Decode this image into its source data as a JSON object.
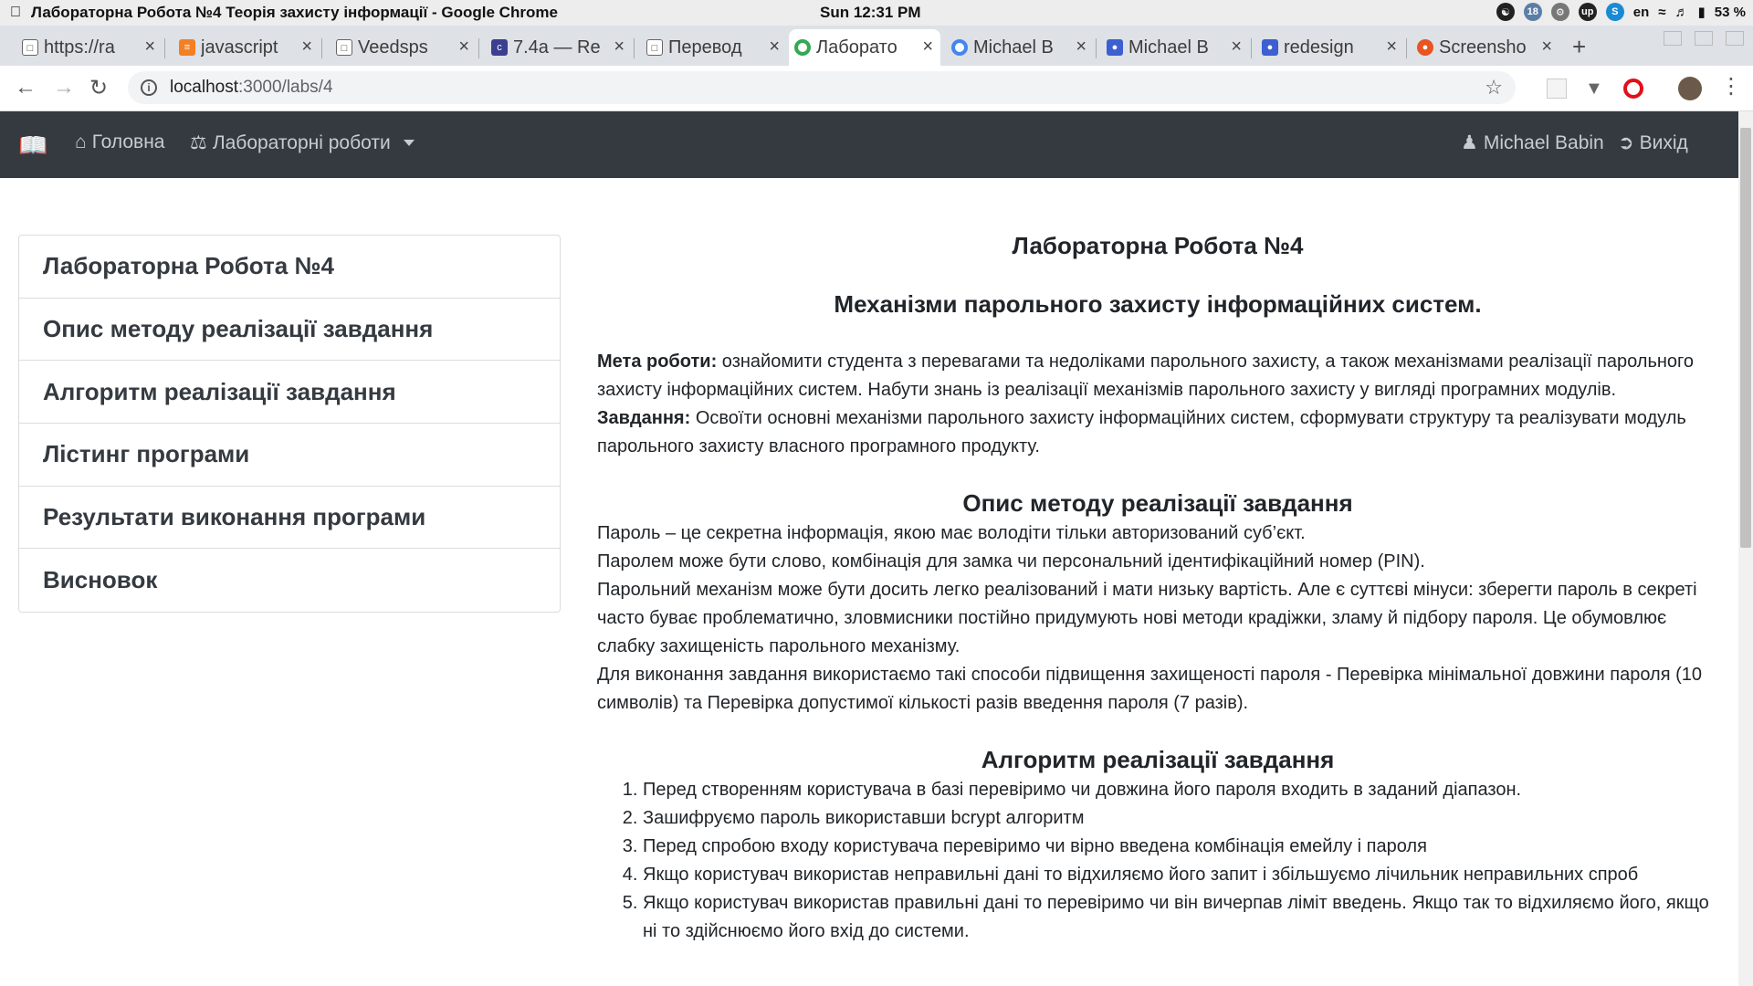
{
  "os": {
    "window_title": "Лабораторна Робота №4 Теорія захисту інформації - Google Chrome",
    "clock": "Sun 12:31 PM",
    "lang": "en",
    "battery": "53 %",
    "tray_badge": "18"
  },
  "tabs": [
    {
      "label": "https://ra",
      "favicon": "page-icon"
    },
    {
      "label": "javascript",
      "favicon": "stackoverflow-icon"
    },
    {
      "label": "Veedsps",
      "favicon": "page-icon"
    },
    {
      "label": "7.4a — Re",
      "favicon": "cpp-icon"
    },
    {
      "label": "Перевод",
      "favicon": "page-icon"
    },
    {
      "label": "Лаборато",
      "favicon": "chrome-icon"
    },
    {
      "label": "Michael B",
      "favicon": "chrome-icon"
    },
    {
      "label": "Michael B",
      "favicon": "app-icon"
    },
    {
      "label": "redesign",
      "favicon": "app-icon"
    },
    {
      "label": "Screensho",
      "favicon": "ubuntu-icon"
    }
  ],
  "address": {
    "host": "localhost",
    "path": ":3000/labs/4"
  },
  "navbar": {
    "home": "Головна",
    "labs": "Лабораторні роботи",
    "user": "Michael Babin",
    "logout": "Вихід"
  },
  "sidebar": {
    "items": [
      {
        "label": "Лабораторна Робота №4"
      },
      {
        "label": "Опис методу реалізації завдання"
      },
      {
        "label": "Алгоритм реалізації завдання"
      },
      {
        "label": "Лістинг програми"
      },
      {
        "label": "Результати виконання програми"
      },
      {
        "label": "Висновок"
      }
    ]
  },
  "content": {
    "title": "Лабораторна Робота №4",
    "subtitle": "Механізми парольного захисту інформаційних систем.",
    "goal_label": "Мета роботи:",
    "goal_text": " ознайомити студента з перевагами та недоліками парольного захисту, а також механізмами реалізації парольного захисту інформаційних систем. Набути знань із реалізації механізмів парольного захисту у вигляді програмних модулів.",
    "task_label": "Завдання:",
    "task_text": " Освоїти основні механізми парольного захисту інформаційних систем, сформувати структуру та реалізувати модуль парольного захисту власного програмного продукту.",
    "method_heading": "Опис методу реалізації завдання",
    "method_paragraphs": [
      "Пароль – це секретна інформація, якою має володіти тільки авторизований суб’єкт.",
      "Паролем може бути слово, комбінація для замка чи персональний ідентифікаційний номер (PIN).",
      "Парольний механізм може бути досить легко реалізований і мати низьку вартість. Але є суттєві мінуси: зберегти пароль в секреті часто буває проблематично, зловмисники постійно придумують нові методи крадіжки, зламу й підбору пароля. Це обумовлює слабку захищеність парольного механізму.",
      "Для виконання завдання використаємо такі способи підвищення захищеності пароля - Перевірка мінімальної довжини пароля (10 символів) та Перевірка допустимої кількості разів введення пароля (7 разів)."
    ],
    "algo_heading": "Алгоритм реалізації завдання",
    "algo_steps": [
      "Перед створенням користувача в базі перевіримо чи довжина його пароля входить в заданий діапазон.",
      "Зашифруємо пароль використавши bcrypt алгоритм",
      "Перед спробою входу користувача перевіримо чи вірно введена комбінація емейлу і пароля",
      "Якщо користувач використав неправильні дані то відхиляємо його запит і збільшуємо лічильник неправильних спроб",
      "Якщо користувач використав правильні дані то перевіримо чи він вичерпав ліміт введень. Якщо так то відхиляємо його, якщо ні то здійснюємо його вхід до системи."
    ]
  },
  "colors": {
    "navbar_bg": "#343a40",
    "tabstrip_bg": "#dee1e6",
    "text": "#212529"
  }
}
